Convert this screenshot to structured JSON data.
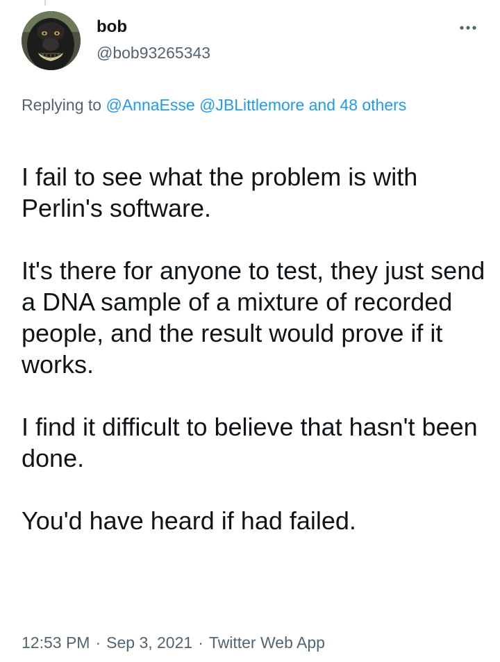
{
  "tweet": {
    "author": {
      "display_name": "bob",
      "handle": "@bob93265343"
    },
    "replying": {
      "prefix": "Replying to",
      "mention_1": "@AnnaEsse",
      "mention_2": "@JBLittlemore",
      "suffix": "and 48 others"
    },
    "body": [
      "I fail to see what the problem is with Perlin's software.",
      "It's there for anyone to test, they just send a DNA sample of a mixture of recorded people, and the result would prove if it works.",
      "I find it difficult to believe that hasn't been done.",
      "You'd have heard if had failed."
    ],
    "meta": {
      "time": "12:53 PM",
      "separator": "·",
      "date": "Sep 3, 2021",
      "source": "Twitter Web App"
    }
  },
  "icons": {
    "more": "more-horizontal-icon",
    "avatar": "monkey-avatar-image"
  },
  "colors": {
    "text_primary": "#0f1419",
    "text_secondary": "#536471",
    "link": "#1d9bf0"
  }
}
